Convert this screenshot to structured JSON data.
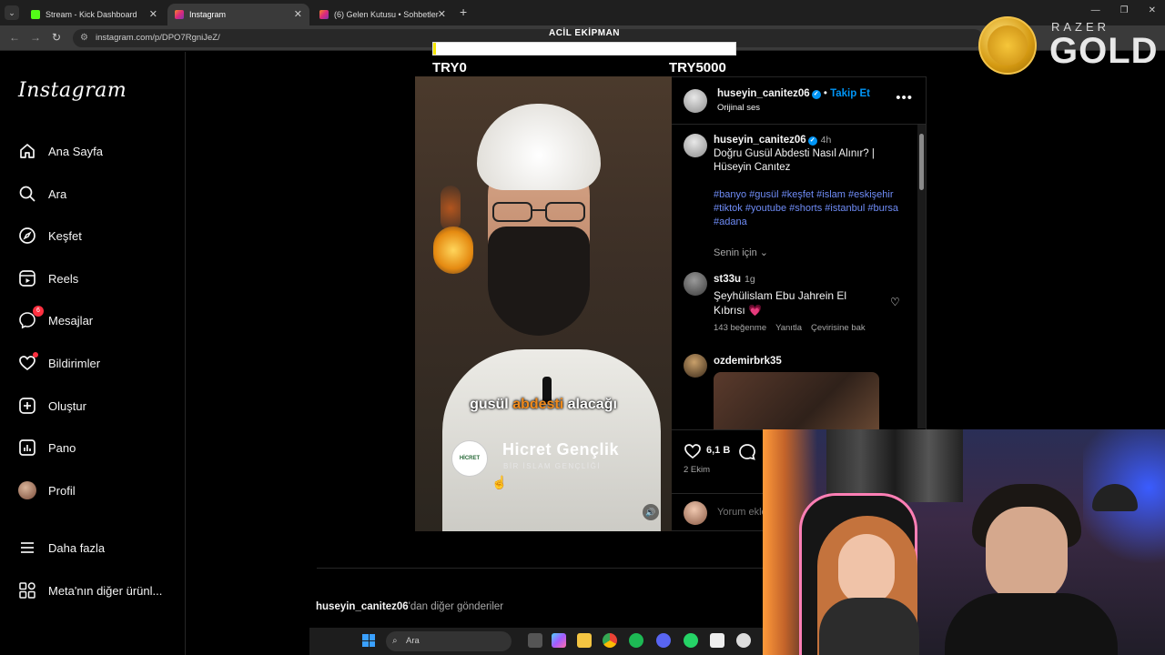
{
  "browser": {
    "tabs": [
      {
        "label": "Stream - Kick Dashboard",
        "favicon_color": "#53fc18",
        "active": false
      },
      {
        "label": "Instagram",
        "favicon_color": "#e1306c",
        "active": true
      },
      {
        "label": "(6) Gelen Kutusu • Sohbetler",
        "favicon_color": "#e1306c",
        "active": false
      }
    ],
    "url": "instagram.com/p/DPO7RgniJeZ/"
  },
  "overlay": {
    "donation_title": "ACİL EKİPMAN",
    "donation_progress": 0.01,
    "min_label": "TRY0",
    "max_label": "TRY5000",
    "brand_top": "RAZER",
    "brand_bottom": "GOLD"
  },
  "instagram": {
    "logo": "Instagram",
    "nav": [
      {
        "label": "Ana Sayfa",
        "icon": "home-icon"
      },
      {
        "label": "Ara",
        "icon": "search-icon"
      },
      {
        "label": "Keşfet",
        "icon": "compass-icon"
      },
      {
        "label": "Reels",
        "icon": "reels-icon"
      },
      {
        "label": "Mesajlar",
        "icon": "messenger-icon",
        "badge": "6"
      },
      {
        "label": "Bildirimler",
        "icon": "heart-icon"
      },
      {
        "label": "Oluştur",
        "icon": "plus-icon"
      },
      {
        "label": "Pano",
        "icon": "dashboard-icon"
      },
      {
        "label": "Profil",
        "icon": "avatar"
      },
      {
        "label": "Daha fazla",
        "icon": "menu-icon"
      },
      {
        "label": "Meta'nın diğer ürünl...",
        "icon": "meta-apps-icon"
      }
    ],
    "post": {
      "author": "huseyin_canitez06",
      "follow_label": "Takip Et",
      "audio": "Orijinal ses",
      "time": "4h",
      "caption": "Doğru Gusül Abdesti Nasıl Alınır? | Hüseyin Canıtez",
      "hashtags": "#banyo #gusül #keşfet #islam #eskişehir #tiktok #youtube #shorts #istanbul #bursa #adana",
      "for_you": "Senin için",
      "video_caption_pre": "gusül ",
      "video_caption_hl": "abdesti",
      "video_caption_post": " alacağı",
      "video_brand": "Hicret Gençlik",
      "video_brand_sub": "BİR İSLAM GENÇLİĞİ",
      "video_logo_text": "HİCRET",
      "likes": "6,1 B",
      "date": "2 Ekim",
      "comment_placeholder": "Yorum ekle..."
    },
    "comments": [
      {
        "user": "st33u",
        "time": "1g",
        "text": "Şeyhülislam Ebu Jahrein El Kıbrısı 💗",
        "likes": "143 beğenme",
        "reply": "Yanıtla",
        "translate": "Çevirisine bak"
      },
      {
        "user": "ozdemirbrk35"
      }
    ],
    "more_posts_user": "huseyin_canitez06",
    "more_posts_suffix": "'dan diğer gönderiler"
  },
  "taskbar": {
    "search_label": "Ara"
  }
}
